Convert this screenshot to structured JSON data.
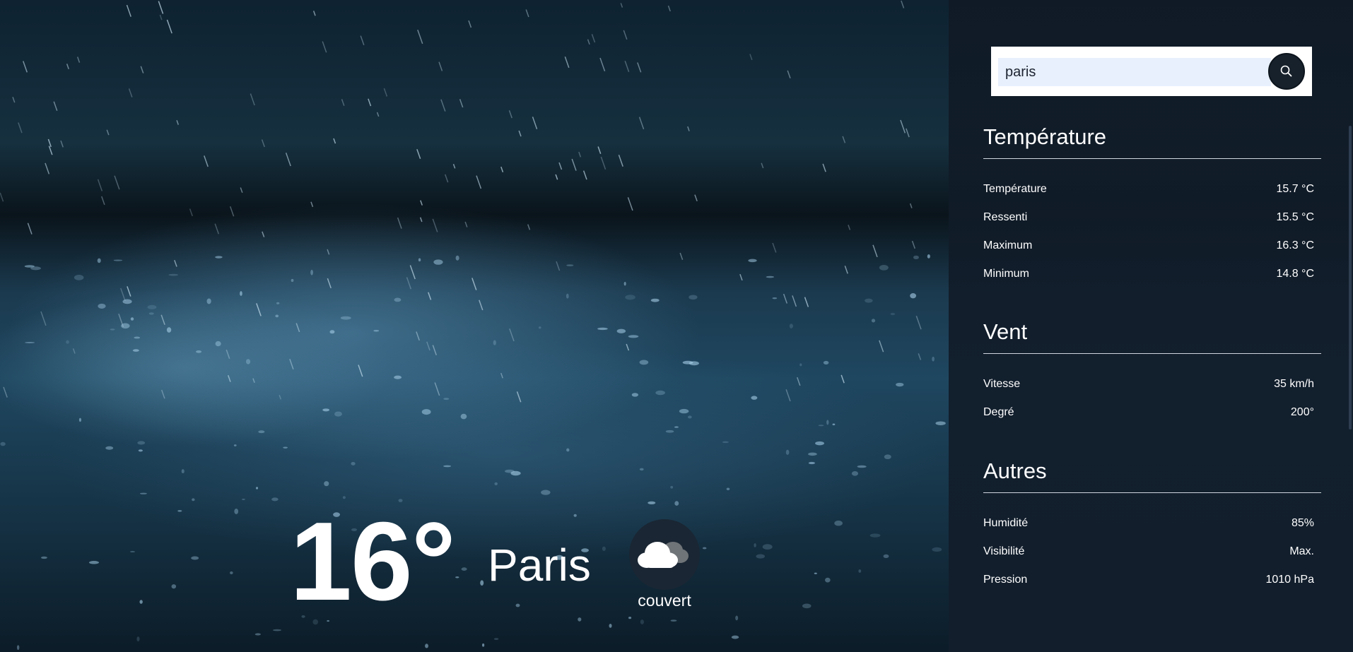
{
  "search": {
    "value": "paris",
    "button_icon": "search-icon"
  },
  "current": {
    "temperature": "16°",
    "city": "Paris",
    "condition": "couvert",
    "condition_icon": "cloud-icon"
  },
  "sections": {
    "temperature": {
      "title": "Température",
      "rows": [
        {
          "label": "Température",
          "value": "15.7 °C"
        },
        {
          "label": "Ressenti",
          "value": "15.5 °C"
        },
        {
          "label": "Maximum",
          "value": "16.3 °C"
        },
        {
          "label": "Minimum",
          "value": "14.8 °C"
        }
      ]
    },
    "wind": {
      "title": "Vent",
      "rows": [
        {
          "label": "Vitesse",
          "value": "35 km/h"
        },
        {
          "label": "Degré",
          "value": "200°"
        }
      ]
    },
    "others": {
      "title": "Autres",
      "rows": [
        {
          "label": "Humidité",
          "value": "85%"
        },
        {
          "label": "Visibilité",
          "value": "Max."
        },
        {
          "label": "Pression",
          "value": "1010 hPa"
        }
      ]
    }
  }
}
